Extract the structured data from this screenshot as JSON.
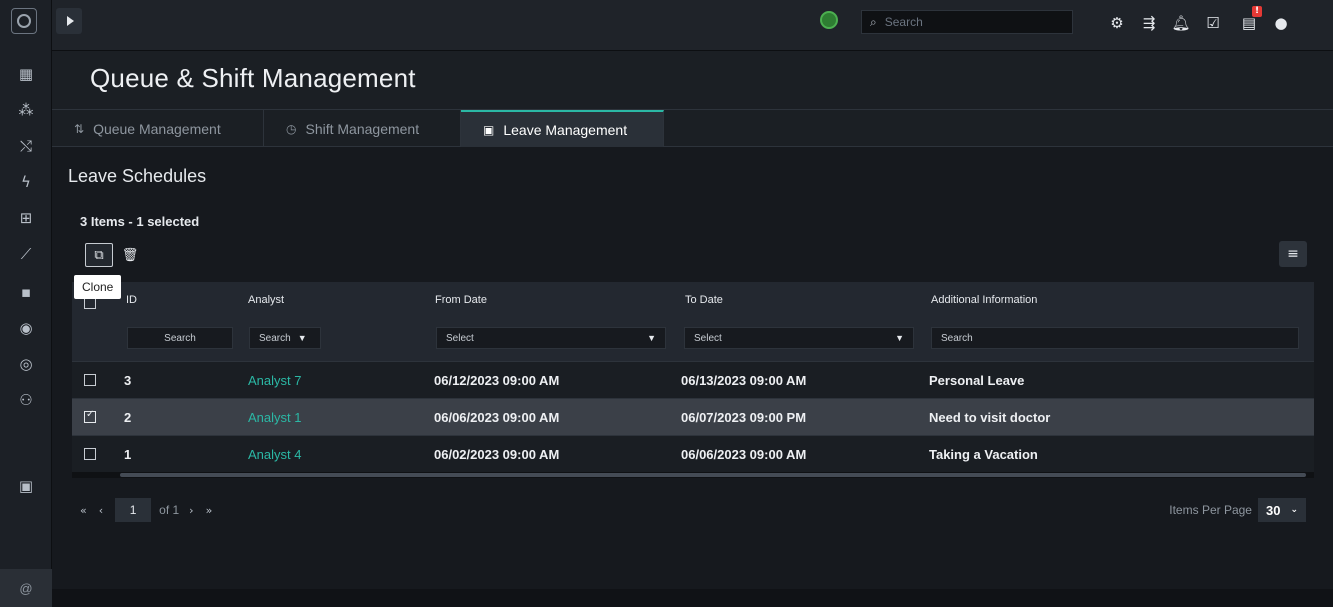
{
  "topbar": {
    "search_placeholder": "Search",
    "notification_badge": "!"
  },
  "page": {
    "title": "Queue & Shift Management"
  },
  "tabs": [
    {
      "label": "Queue Management",
      "icon": "queue-icon"
    },
    {
      "label": "Shift Management",
      "icon": "clock-icon"
    },
    {
      "label": "Leave Management",
      "icon": "calendar-icon",
      "active": true
    }
  ],
  "leave": {
    "section_title": "Leave Schedules",
    "item_count": "3 Items - 1 selected",
    "tooltip": "Clone"
  },
  "grid": {
    "headers": {
      "id": "ID",
      "analyst": "Analyst",
      "from_date": "From Date",
      "to_date": "To Date",
      "info": "Additional Information"
    },
    "filters": {
      "id": "Search",
      "analyst": "Search",
      "from_date": "Select",
      "to_date": "Select",
      "info": "Search"
    },
    "rows": [
      {
        "id": "3",
        "analyst": "Analyst 7",
        "from": "06/12/2023 09:00 AM",
        "to": "06/13/2023 09:00 AM",
        "info": "Personal Leave",
        "selected": false
      },
      {
        "id": "2",
        "analyst": "Analyst 1",
        "from": "06/06/2023 09:00 AM",
        "to": "06/07/2023 09:00 PM",
        "info": "Need to visit doctor",
        "selected": true
      },
      {
        "id": "1",
        "analyst": "Analyst 4",
        "from": "06/02/2023 09:00 AM",
        "to": "06/06/2023 09:00 AM",
        "info": "Taking a Vacation",
        "selected": false
      }
    ]
  },
  "pager": {
    "first": "«",
    "prev": "‹",
    "page": "1",
    "of": "of 1",
    "next": "›",
    "last": "»",
    "items_per_page_label": "Items Per Page",
    "items_per_page_value": "30"
  },
  "colors": {
    "accent": "#2bb8a5",
    "background": "#16191e",
    "selected_row": "#3b4048"
  }
}
